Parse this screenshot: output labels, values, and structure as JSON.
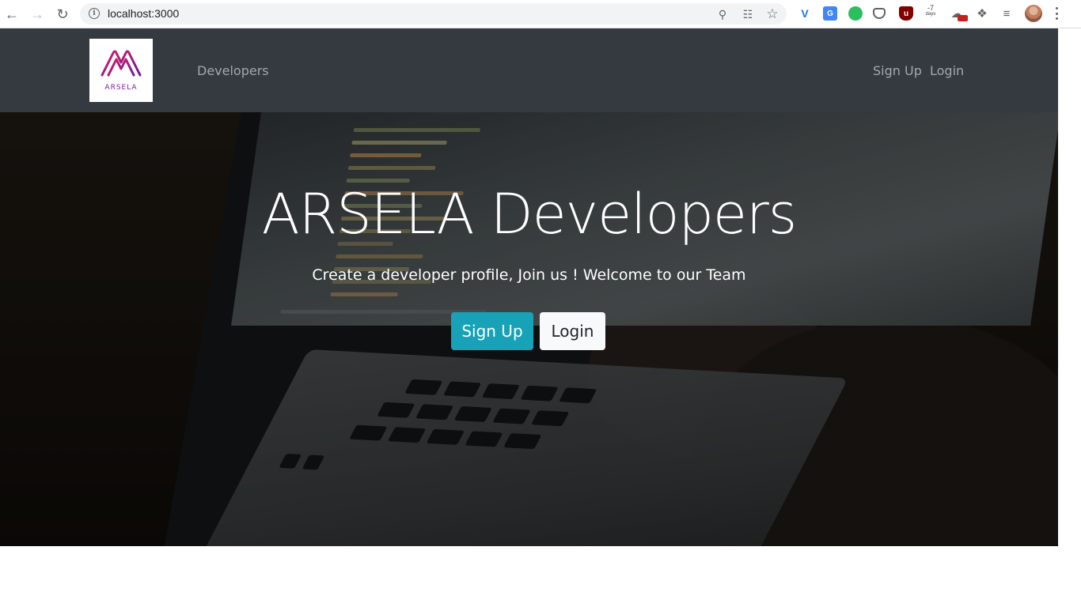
{
  "browser": {
    "url": "localhost:3000",
    "ext_counter": "-7",
    "ext_counter_unit": "days"
  },
  "navbar": {
    "logo_text": "ARSELA",
    "links": [
      {
        "label": "Developers"
      },
      {
        "label": "Sign Up"
      },
      {
        "label": "Login"
      }
    ]
  },
  "hero": {
    "title": "ARSELA Developers",
    "subtitle": "Create a developer profile, Join us ! Welcome to our Team",
    "signup_label": "Sign Up",
    "login_label": "Login"
  },
  "colors": {
    "navbar_bg": "#343a40",
    "accent": "#17a2b8",
    "logo_purple": "#8e24aa"
  }
}
